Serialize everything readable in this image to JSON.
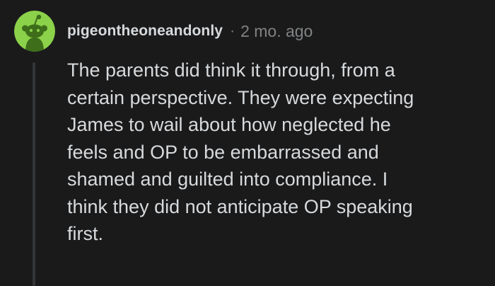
{
  "comment": {
    "author": "pigeontheoneandonly",
    "separator": "·",
    "timestamp": "2 mo. ago",
    "body_lines": [
      "The parents did think it through, from a",
      "certain perspective. They were expecting",
      "James to wail about how neglected he",
      "feels and OP to be embarrassed and",
      "shamed and guilted into compliance. I",
      "think they did not anticipate OP speaking",
      "first."
    ],
    "avatar_icon": "snoo-avatar-icon",
    "colors": {
      "background": "#1a1a1b",
      "avatar_bg": "#8bd14a",
      "text": "#d7dadc",
      "meta": "#818384",
      "thread_line": "#343536"
    }
  }
}
